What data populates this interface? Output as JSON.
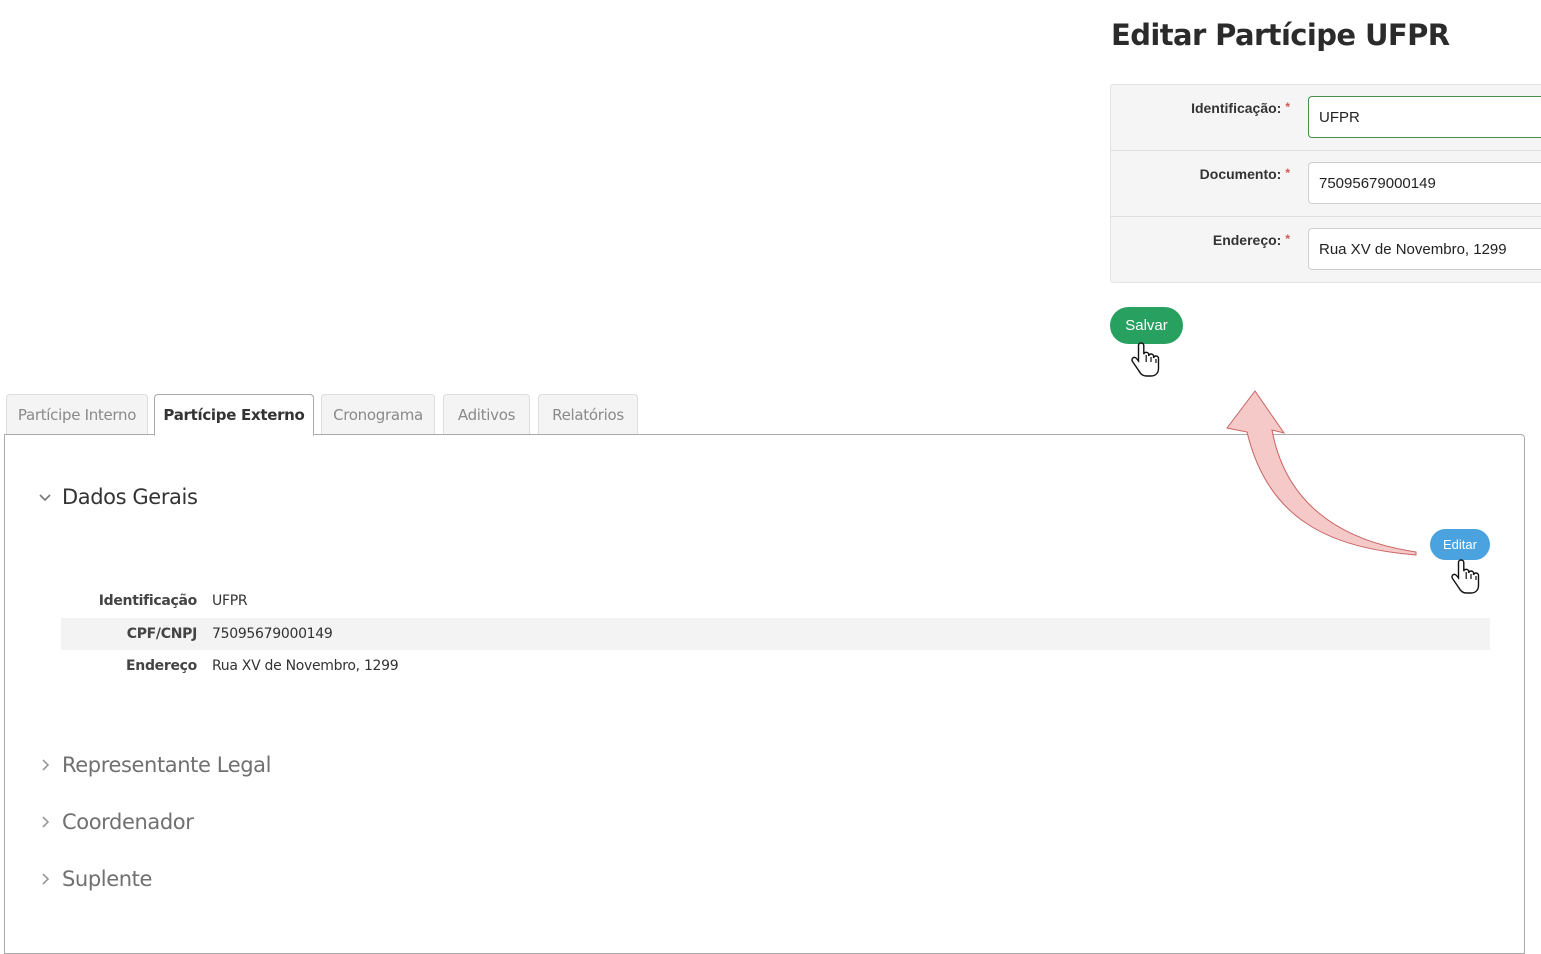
{
  "edit_form": {
    "title": "Editar Partícipe UFPR",
    "fields": [
      {
        "label": "Identificação:",
        "required_mark": "*",
        "value": "UFPR"
      },
      {
        "label": "Documento:",
        "required_mark": "*",
        "value": "75095679000149"
      },
      {
        "label": "Endereço:",
        "required_mark": "*",
        "value": "Rua XV de Novembro, 1299"
      }
    ],
    "save_label": "Salvar"
  },
  "tabs": [
    {
      "label": "Partícipe Interno",
      "active": false
    },
    {
      "label": "Partícipe Externo",
      "active": true
    },
    {
      "label": "Cronograma",
      "active": false
    },
    {
      "label": "Aditivos",
      "active": false
    },
    {
      "label": "Relatórios",
      "active": false
    }
  ],
  "sections": {
    "dados_gerais": {
      "title": "Dados Gerais",
      "expanded": true,
      "edit_label": "Editar",
      "rows": [
        {
          "label": "Identificação",
          "value": "UFPR"
        },
        {
          "label": "CPF/CNPJ",
          "value": "75095679000149"
        },
        {
          "label": "Endereço",
          "value": "Rua XV de Novembro, 1299"
        }
      ]
    },
    "representante_legal": {
      "title": "Representante Legal",
      "expanded": false
    },
    "coordenador": {
      "title": "Coordenador",
      "expanded": false
    },
    "suplente": {
      "title": "Suplente",
      "expanded": false
    }
  },
  "annotations": {
    "arrow_icon": "curved-arrow-icon",
    "cursor_icon": "hand-pointer-icon"
  },
  "colors": {
    "save_button": "#27a060",
    "edit_button": "#4aa3df",
    "required_mark": "#d9534f",
    "arrow_fill": "#f6c9c9",
    "arrow_stroke": "#c0504d"
  }
}
